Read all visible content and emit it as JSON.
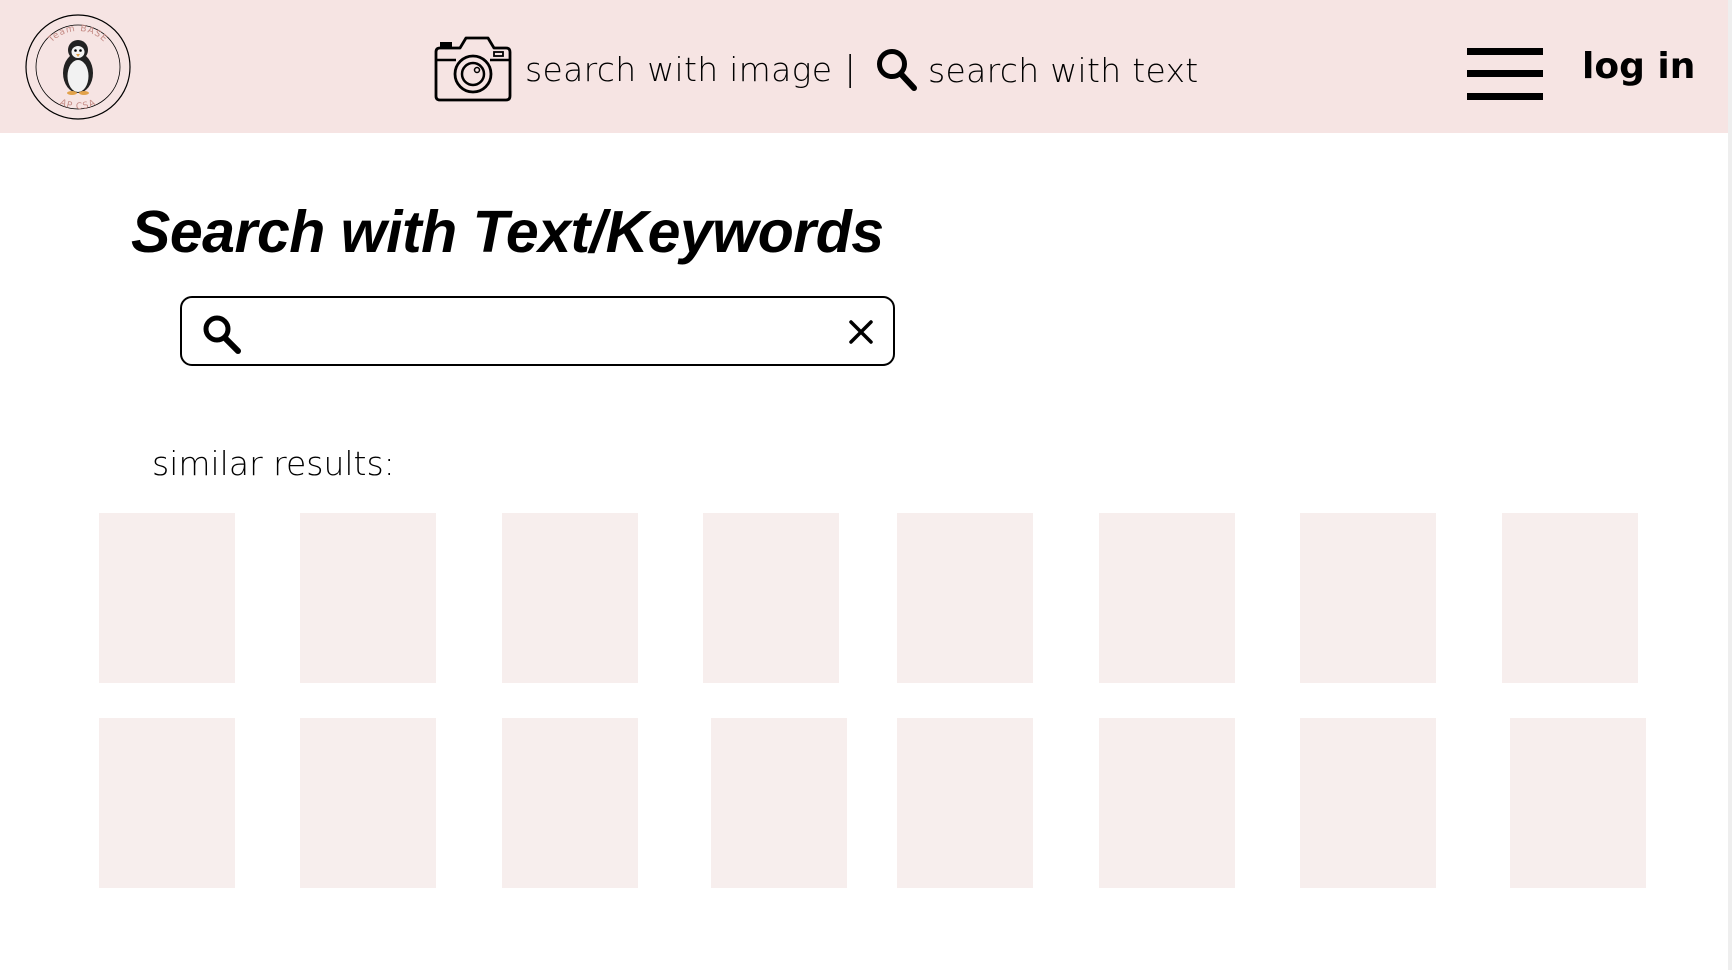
{
  "header": {
    "logo": {
      "top_text": "Team BASE",
      "bottom_text": "AP CSA",
      "icon": "penguin-logo-icon"
    },
    "nav": {
      "image_search_label": "search with image",
      "separator": "|",
      "text_search_label": "search with text",
      "image_search_icon": "camera-icon",
      "text_search_icon": "search-icon"
    },
    "menu_icon": "hamburger-menu-icon",
    "login_label": "log in"
  },
  "main": {
    "title": "Search with Text/Keywords",
    "search": {
      "value": "",
      "placeholder": "",
      "icon": "search-icon",
      "clear_icon": "close-icon"
    },
    "similar_results_label": "similar results:",
    "results": {
      "rows": 2,
      "per_row": 8,
      "tile_color": "#f7eeed"
    }
  },
  "colors": {
    "header_background": "#f6e4e3",
    "tile_placeholder": "#f7eeed",
    "text": "#000000"
  }
}
